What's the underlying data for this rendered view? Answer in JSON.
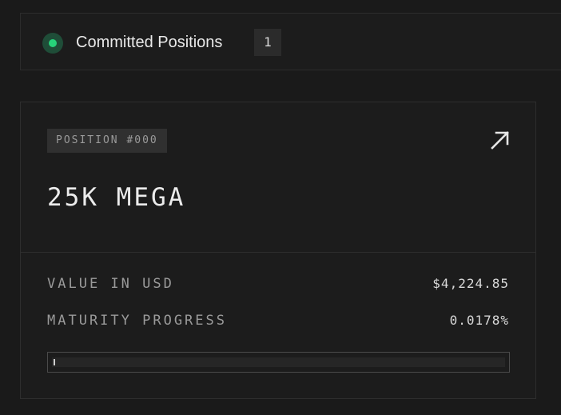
{
  "header": {
    "title": "Committed Positions",
    "count": "1",
    "status_color": "#27d27a"
  },
  "position_card": {
    "tag": "POSITION #000",
    "name": "25K MEGA",
    "open_icon": "arrow-up-right-icon",
    "rows": [
      {
        "label": "VALUE IN USD",
        "value": "$4,224.85"
      },
      {
        "label": "MATURITY PROGRESS",
        "value": "0.0178%"
      }
    ],
    "progress_percent": 0.0178
  }
}
